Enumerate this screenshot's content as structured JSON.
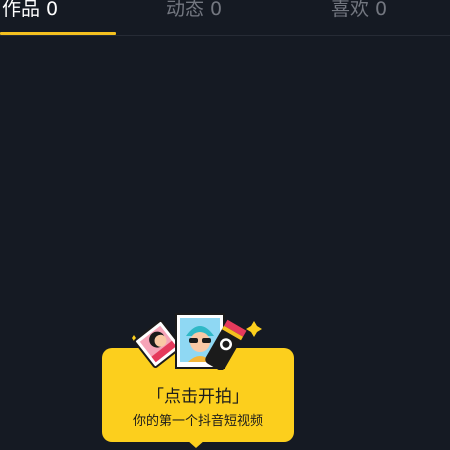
{
  "tabs": [
    {
      "label": "作品 0",
      "active": true
    },
    {
      "label": "动态 0",
      "active": false
    },
    {
      "label": "喜欢 0",
      "active": false
    }
  ],
  "colors": {
    "background": "#151a23",
    "accent": "#f4c01f",
    "tooltip": "#fccf1d"
  },
  "prompt": {
    "title": "「点击开拍」",
    "subtitle": "你的第一个抖音短视频"
  },
  "illustration": {
    "icons": [
      "photo-card-icon",
      "avatar-photo-icon",
      "camera-icon",
      "sparkle-icon"
    ]
  }
}
